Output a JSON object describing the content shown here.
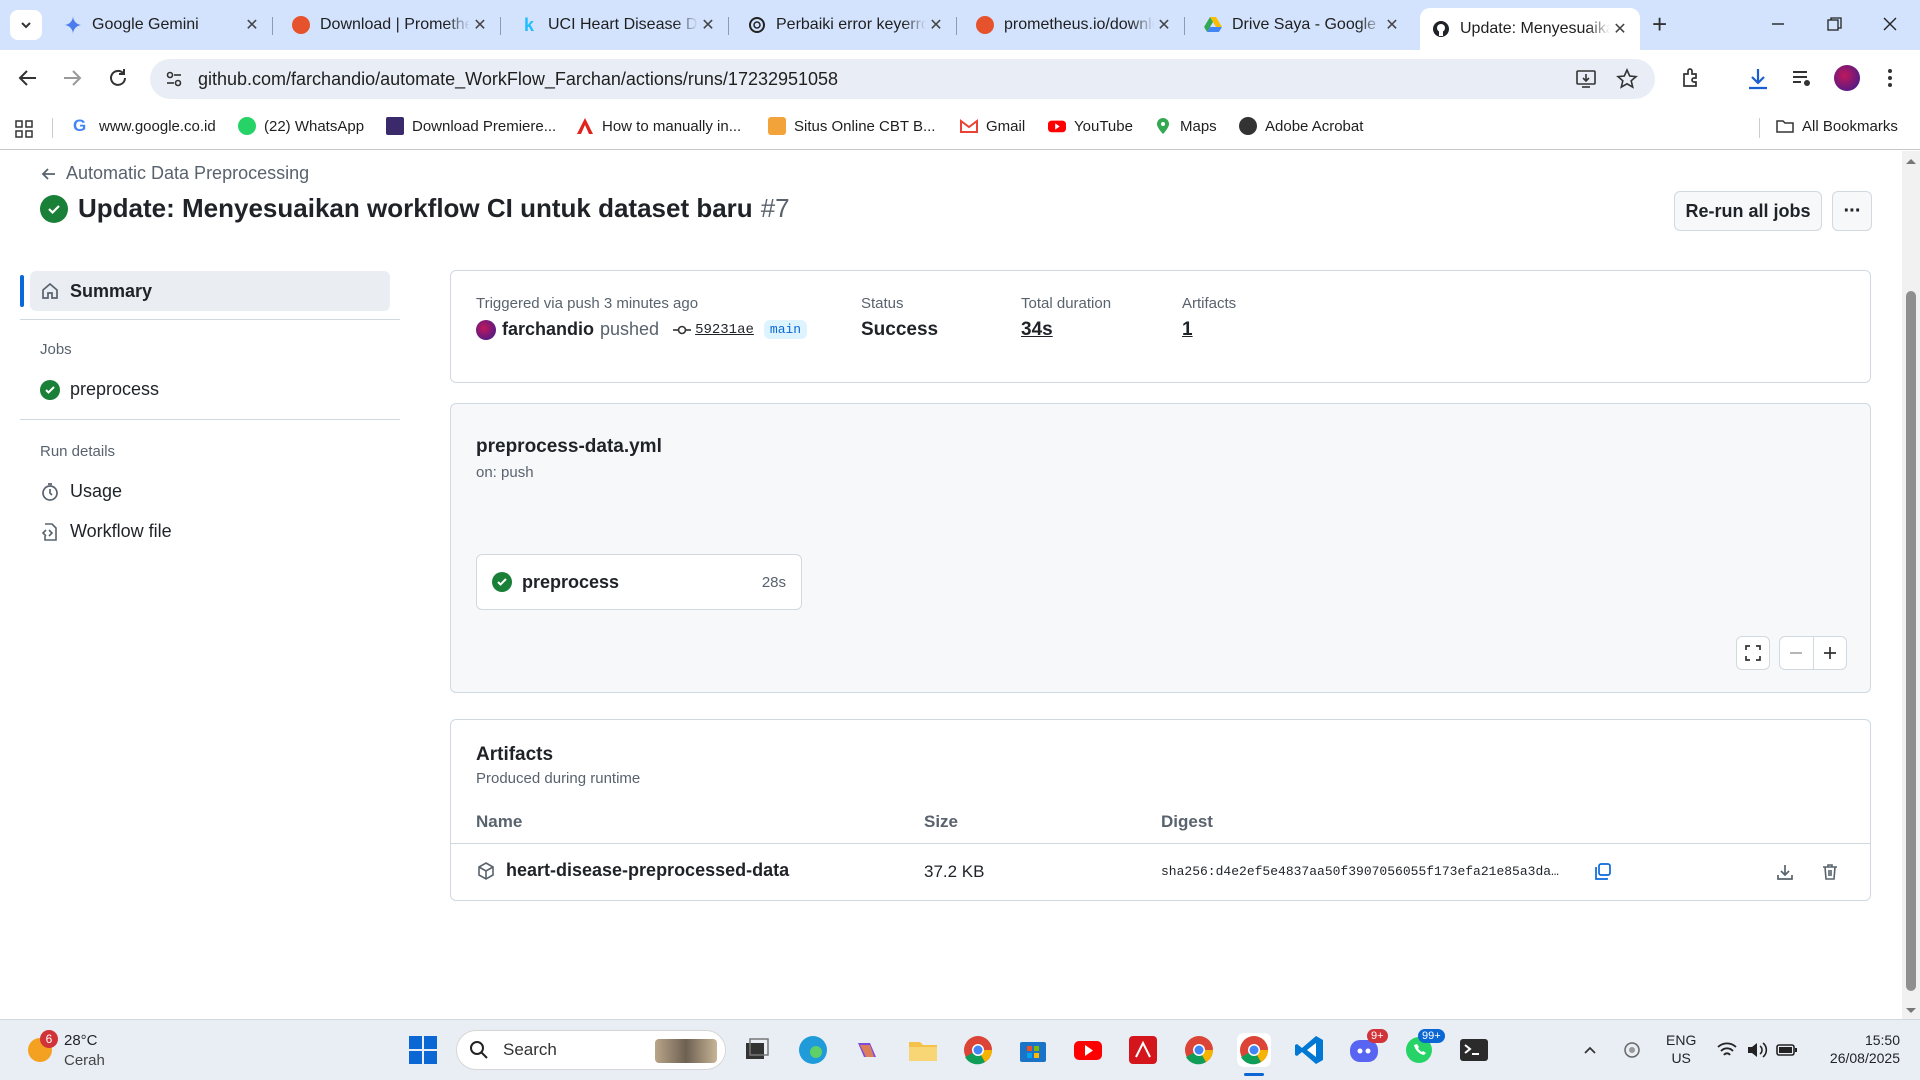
{
  "browser": {
    "tabs": [
      {
        "title": "Google Gemini"
      },
      {
        "title": "Download | Prometheus"
      },
      {
        "title": "UCI Heart Disease Data"
      },
      {
        "title": "Perbaiki error keyerror"
      },
      {
        "title": "prometheus.io/download"
      },
      {
        "title": "Drive Saya - Google Drive"
      },
      {
        "title": "Update: Menyesuaikan"
      }
    ],
    "url": "github.com/farchandio/automate_WorkFlow_Farchan/actions/runs/17232951058",
    "bookmarks": [
      "www.google.co.id",
      "(22) WhatsApp",
      "Download Premiere...",
      "How to manually in...",
      "Situs Online CBT B...",
      "Gmail",
      "YouTube",
      "Maps",
      "Adobe Acrobat"
    ],
    "all_bookmarks": "All Bookmarks"
  },
  "header": {
    "back_link": "Automatic Data Preprocessing",
    "title": "Update: Menyesuaikan workflow CI untuk dataset baru",
    "run_number": "#7",
    "rerun_button": "Re-run all jobs",
    "more_button": "···"
  },
  "sidebar": {
    "summary": "Summary",
    "jobs_heading": "Jobs",
    "job": "preprocess",
    "run_details_heading": "Run details",
    "usage": "Usage",
    "workflow_file": "Workflow file"
  },
  "summary": {
    "trigger": "Triggered via push 3 minutes ago",
    "actor": "farchandio",
    "action": "pushed",
    "commit": "59231ae",
    "branch": "main",
    "status_label": "Status",
    "status_value": "Success",
    "duration_label": "Total duration",
    "duration_value": "34s",
    "artifacts_label": "Artifacts",
    "artifacts_value": "1"
  },
  "workflow": {
    "file": "preprocess-data.yml",
    "trigger": "on: push",
    "job_name": "preprocess",
    "job_time": "28s"
  },
  "artifacts": {
    "title": "Artifacts",
    "subtitle": "Produced during runtime",
    "columns": [
      "Name",
      "Size",
      "Digest"
    ],
    "rows": [
      {
        "name": "heart-disease-preprocessed-data",
        "size": "37.2 KB",
        "digest": "sha256:d4e2ef5e4837aa50f3907056055f173efa21e85a3da…"
      }
    ]
  },
  "taskbar": {
    "weather_temp": "28°C",
    "weather_desc": "Cerah",
    "weather_badge": "6",
    "search": "Search",
    "lang_top": "ENG",
    "lang_bottom": "US",
    "time": "15:50",
    "date": "26/08/2025",
    "badge_discord": "9+",
    "badge_whatsapp": "99+"
  },
  "colors": {
    "success": "#1a7f37",
    "accent_link": "#0969da",
    "tab_bar": "#d3e3fd"
  }
}
